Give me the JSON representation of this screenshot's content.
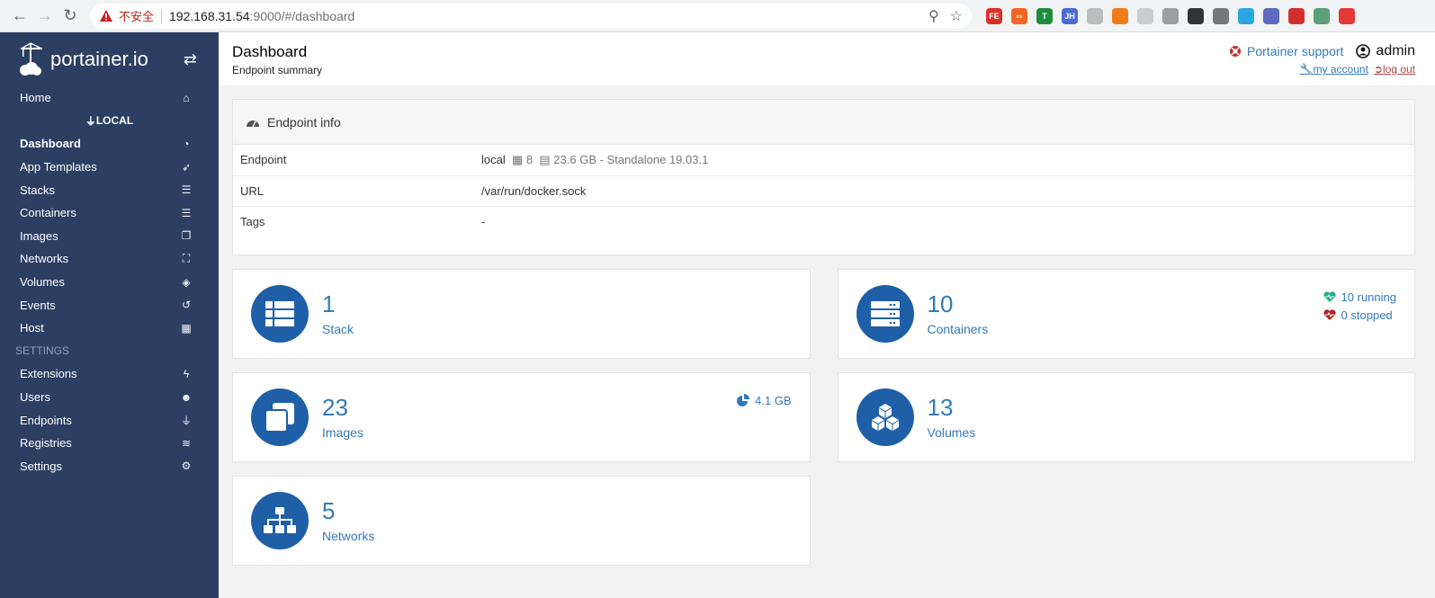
{
  "browser": {
    "insecure_label": "不安全",
    "url_host": "192.168.31.54",
    "url_path": ":9000/#/dashboard",
    "extensions": [
      {
        "name": "fe-extension",
        "label": "FE",
        "color": "#d93025"
      },
      {
        "name": "infinity-extension",
        "label": "∞",
        "color": "#f26522"
      },
      {
        "name": "shield-extension",
        "label": "T",
        "color": "#1e8e3e"
      },
      {
        "name": "jh-extension",
        "label": "JH",
        "color": "#4a6bd6"
      },
      {
        "name": "circle-extension",
        "label": "",
        "color": "#bdbdbd"
      },
      {
        "name": "orange-extension",
        "label": "",
        "color": "#f07c19"
      },
      {
        "name": "grid-extension",
        "label": "",
        "color": "#cccccc"
      },
      {
        "name": "dots-extension",
        "label": "",
        "color": "#9e9e9e"
      },
      {
        "name": "box-extension",
        "label": "",
        "color": "#333333"
      },
      {
        "name": "v-extension",
        "label": "",
        "color": "#777777"
      },
      {
        "name": "cyan-extension",
        "label": "",
        "color": "#29a8e0"
      },
      {
        "name": "check-extension",
        "label": "",
        "color": "#5c6bc0"
      },
      {
        "name": "flash-extension",
        "label": "",
        "color": "#d32f2f"
      },
      {
        "name": "globe-extension",
        "label": "",
        "color": "#5aa07a"
      },
      {
        "name": "up-extension",
        "label": "",
        "color": "#e53935"
      }
    ]
  },
  "sidebar": {
    "logo_text": "portainer.io",
    "items": [
      {
        "label": "Home",
        "icon": "home-icon",
        "glyph": "⌂",
        "type": "item"
      },
      {
        "label": "LOCAL",
        "icon": "plug-icon",
        "glyph": "⏚",
        "type": "endpoint"
      },
      {
        "label": "Dashboard",
        "icon": "tachometer-icon",
        "glyph": "◔",
        "type": "active"
      },
      {
        "label": "App Templates",
        "icon": "rocket-icon",
        "glyph": "➶",
        "type": "item"
      },
      {
        "label": "Stacks",
        "icon": "th-list-icon",
        "glyph": "☰",
        "type": "item"
      },
      {
        "label": "Containers",
        "icon": "server-icon",
        "glyph": "☰",
        "type": "item"
      },
      {
        "label": "Images",
        "icon": "clone-icon",
        "glyph": "❐",
        "type": "item"
      },
      {
        "label": "Networks",
        "icon": "sitemap-icon",
        "glyph": "⛶",
        "type": "item"
      },
      {
        "label": "Volumes",
        "icon": "cubes-icon",
        "glyph": "◈",
        "type": "item"
      },
      {
        "label": "Events",
        "icon": "history-icon",
        "glyph": "↺",
        "type": "item"
      },
      {
        "label": "Host",
        "icon": "th-icon",
        "glyph": "▦",
        "type": "item"
      },
      {
        "label": "SETTINGS",
        "icon": "",
        "glyph": "",
        "type": "section"
      },
      {
        "label": "Extensions",
        "icon": "bolt-icon",
        "glyph": "ϟ",
        "type": "item"
      },
      {
        "label": "Users",
        "icon": "users-icon",
        "glyph": "☻",
        "type": "item"
      },
      {
        "label": "Endpoints",
        "icon": "plug-icon",
        "glyph": "⏚",
        "type": "item"
      },
      {
        "label": "Registries",
        "icon": "database-icon",
        "glyph": "≋",
        "type": "item"
      },
      {
        "label": "Settings",
        "icon": "cogs-icon",
        "glyph": "⚙",
        "type": "item"
      }
    ]
  },
  "header": {
    "title": "Dashboard",
    "subtitle": "Endpoint summary",
    "support_label": "Portainer support",
    "username": "admin",
    "my_account": "my account",
    "log_out": "log out"
  },
  "endpoint_info": {
    "title": "Endpoint info",
    "rows": {
      "endpoint_label": "Endpoint",
      "endpoint_name": "local",
      "cpu": "8",
      "memory_details": "23.6 GB - Standalone 19.03.1",
      "url_label": "URL",
      "url_value": "/var/run/docker.sock",
      "tags_label": "Tags",
      "tags_value": "-"
    }
  },
  "tiles": {
    "stacks": {
      "count": "1",
      "label": "Stack"
    },
    "containers": {
      "count": "10",
      "label": "Containers",
      "running": "10 running",
      "stopped": "0 stopped"
    },
    "images": {
      "count": "23",
      "label": "Images",
      "size": "4.1 GB"
    },
    "volumes": {
      "count": "13",
      "label": "Volumes"
    },
    "networks": {
      "count": "5",
      "label": "Networks"
    }
  },
  "colors": {
    "sidebar_bg": "#2d3e63",
    "accent": "#337ab7",
    "tile_icon_bg": "#1f5fa8",
    "running": "#23ae89",
    "stopped": "#ae2323"
  }
}
